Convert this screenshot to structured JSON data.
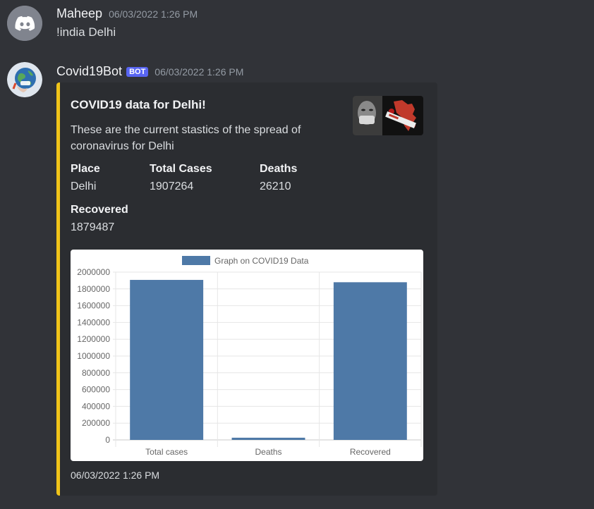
{
  "messages": [
    {
      "username": "Maheep",
      "timestamp": "06/03/2022 1:26 PM",
      "text": "!india Delhi"
    },
    {
      "username": "Covid19Bot",
      "bot_tag": "BOT",
      "timestamp": "06/03/2022 1:26 PM"
    }
  ],
  "embed": {
    "accent_color": "#f0c419",
    "title": "COVID19 data for Delhi!",
    "description": "These are the current stastics of the spread of coronavirus for Delhi",
    "fields": [
      {
        "name": "Place",
        "value": "Delhi"
      },
      {
        "name": "Total Cases",
        "value": "1907264"
      },
      {
        "name": "Deaths",
        "value": "26210"
      },
      {
        "name": "Recovered",
        "value": "1879487"
      }
    ],
    "footer": "06/03/2022 1:26 PM"
  },
  "chart_data": {
    "type": "bar",
    "legend": [
      "Graph on COVID19 Data"
    ],
    "legend_position": "top",
    "categories": [
      "Total cases",
      "Deaths",
      "Recovered"
    ],
    "series": [
      {
        "name": "Graph on COVID19 Data",
        "values": [
          1907264,
          26210,
          1879487
        ],
        "color": "#4e79a7"
      }
    ],
    "ylim": [
      0,
      2000000
    ],
    "yticks": [
      0,
      200000,
      400000,
      600000,
      800000,
      1000000,
      1200000,
      1400000,
      1600000,
      1800000,
      2000000
    ],
    "grid": true
  }
}
